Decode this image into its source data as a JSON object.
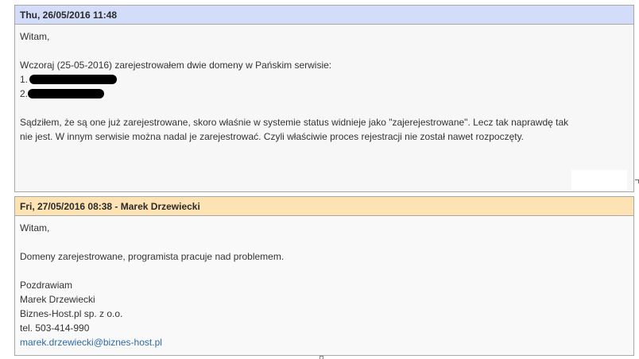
{
  "messages": [
    {
      "header": "Thu, 26/05/2016 11:48",
      "greeting": "Witam,",
      "intro": "Wczoraj (25-05-2016) zarejestrowałem dwie domeny w Pańskim serwisie:",
      "items": [
        "1.",
        "2."
      ],
      "paragraph_line1": "Sądziłem, że są one już zarejestrowane, skoro właśnie w systemie status widnieje jako \"zajerejestrowane\". Lecz tak naprawdę tak",
      "paragraph_line2": "nie jest. W innym serwisie można nadal je zarejestrować. Czyli właściwie proces rejestracji nie został nawet rozpoczęty."
    },
    {
      "header": "Fri, 27/05/2016 08:38 - Marek Drzewiecki",
      "greeting": "Witam,",
      "body": "Domeny zarejestrowane, programista pracuje nad problemem.",
      "signature": {
        "closing": "Pozdrawiam",
        "name": "Marek Drzewiecki",
        "company": "Biznes-Host.pl sp. z o.o.",
        "phone": "tel. 503-414-990",
        "email": "marek.drzewiecki@biznes-host.pl"
      }
    }
  ],
  "colors": {
    "header_blue": "#d3ddf9",
    "header_orange": "#fde3b3",
    "border": "#a8a8a8",
    "link": "#2d6aa3",
    "redaction": "#000000"
  }
}
